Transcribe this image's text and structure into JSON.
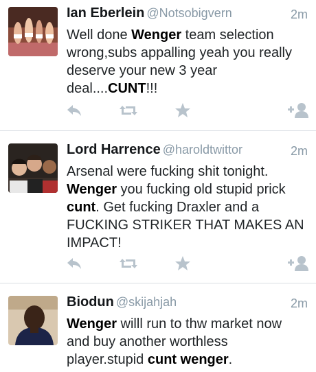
{
  "tweets": [
    {
      "author": "Ian Eberlein",
      "handle": "@Notsobigvern",
      "time": "2m",
      "avatar": "avatar-party-photo",
      "text": [
        {
          "t": "Well done ",
          "b": false
        },
        {
          "t": "Wenger",
          "b": true
        },
        {
          "t": " team selection wrong,subs appalling yeah you really deserve your new 3 year deal....",
          "b": false
        },
        {
          "t": "CUNT",
          "b": true
        },
        {
          "t": "!!!",
          "b": false
        }
      ],
      "actions": [
        "reply-icon",
        "retweet-icon",
        "favorite-icon",
        "follow-icon"
      ]
    },
    {
      "author": "Lord Harrence",
      "handle": "@haroldtwittor",
      "time": "2m",
      "avatar": "avatar-group-photo",
      "text": [
        {
          "t": "Arsenal were fucking shit tonight. ",
          "b": false
        },
        {
          "t": "Wenger",
          "b": true
        },
        {
          "t": " you fucking old stupid prick ",
          "b": false
        },
        {
          "t": "cunt",
          "b": true
        },
        {
          "t": ". Get fucking Draxler and a FUCKING STRIKER THAT MAKES AN IMPACT!",
          "b": false
        }
      ],
      "actions": [
        "reply-icon",
        "retweet-icon",
        "favorite-icon",
        "follow-icon"
      ]
    },
    {
      "author": "Biodun",
      "handle": "@skijahjah",
      "time": "2m",
      "avatar": "avatar-portrait-photo",
      "text": [
        {
          "t": "Wenger",
          "b": true
        },
        {
          "t": " willl run to thw market now and buy another worthless player.stupid ",
          "b": false
        },
        {
          "t": "cunt wenger",
          "b": true
        },
        {
          "t": ".",
          "b": false
        }
      ],
      "actions": []
    }
  ],
  "colors": {
    "icon": "#b8c3cc",
    "name": "#14171a",
    "meta": "#8899a6",
    "divider": "#d8dde2"
  }
}
